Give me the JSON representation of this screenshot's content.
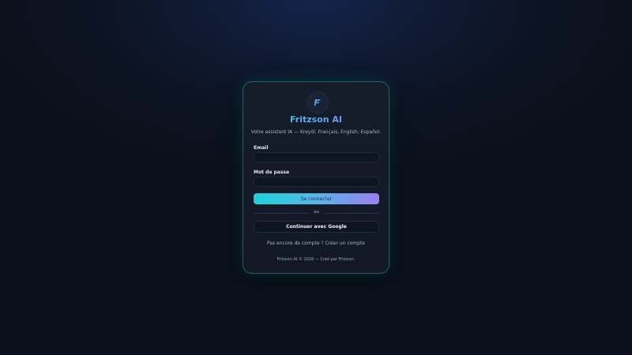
{
  "brand": {
    "logo_icon": "fritzson-f-logo-icon",
    "title": "Fritzson AI",
    "subtitle": "Votre assistant IA — Kreyòl, Français, English, Español.",
    "accent_start": "#1ed2d8",
    "accent_end": "#9a7df0"
  },
  "form": {
    "email_label": "Email",
    "email_value": "",
    "password_label": "Mot de passe",
    "password_value": "",
    "submit_label": "Se connecter"
  },
  "divider": {
    "label": "ou"
  },
  "google_button": {
    "label": "Continuer avec Google"
  },
  "signup": {
    "prompt": "Pas encore de compte ?",
    "link": "Créer un compte"
  },
  "footer": {
    "text": "Fritzson AI © 2026 — Créé par Fritzson."
  }
}
